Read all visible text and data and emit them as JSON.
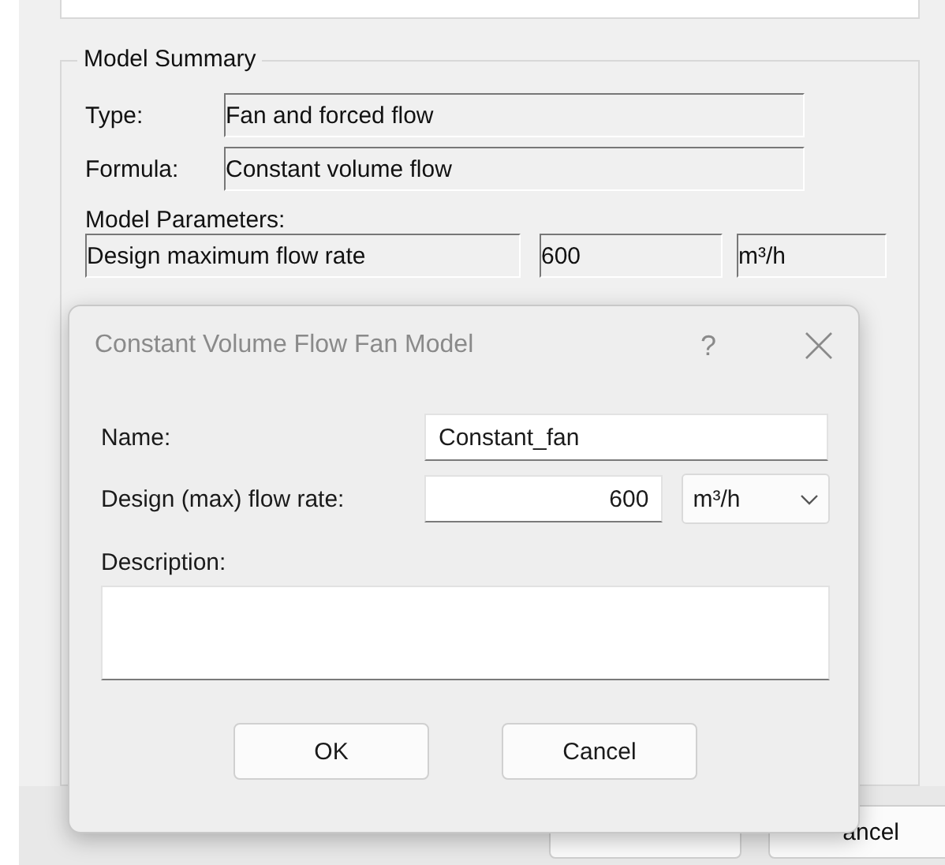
{
  "background_window": {
    "model_summary": {
      "title": "Model Summary",
      "type": {
        "label": "Type:",
        "value": "Fan and forced flow"
      },
      "formula": {
        "label": "Formula:",
        "value": "Constant volume flow"
      },
      "parameters_label": "Model Parameters:",
      "parameters": [
        {
          "name": "Design maximum flow rate",
          "value": "600",
          "unit": "m³/h"
        }
      ]
    },
    "buttons": [
      "ancel"
    ]
  },
  "dialog": {
    "title": "Constant Volume Flow Fan Model",
    "help": "?",
    "name": {
      "label": "Name:",
      "value": "Constant_fan"
    },
    "flow_rate": {
      "label": "Design (max) flow rate:",
      "value": "600",
      "unit": "m³/h"
    },
    "description": {
      "label": "Description:"
    },
    "buttons": [
      "OK",
      "Cancel"
    ]
  }
}
